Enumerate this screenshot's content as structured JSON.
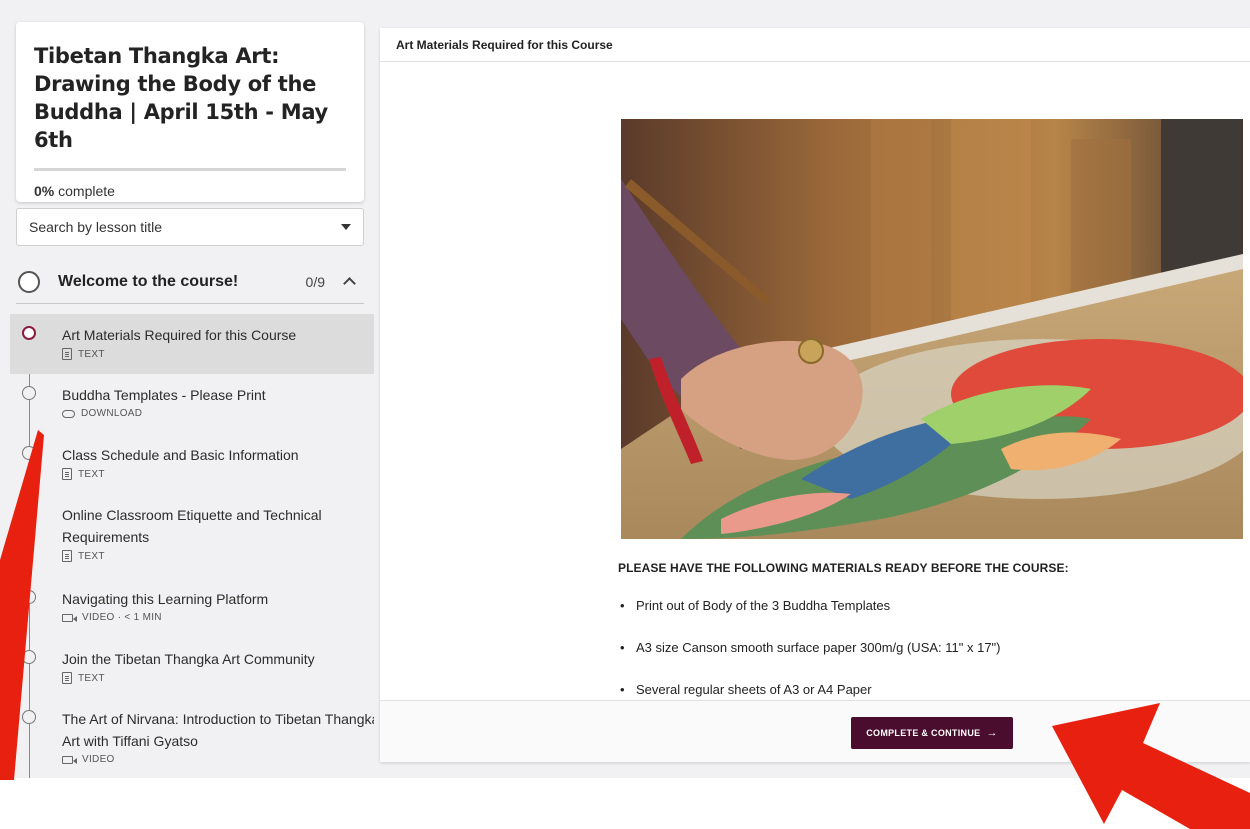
{
  "course": {
    "title": "Tibetan Thangka Art: Drawing the Body of the Buddha | April 15th - May 6th",
    "progress_percent": 0,
    "progress_value": "0%",
    "progress_suffix": " complete"
  },
  "search": {
    "label": "Search by lesson title"
  },
  "section": {
    "title": "Welcome to the course!",
    "count": "0/9"
  },
  "lessons": [
    {
      "title": "Art Materials Required for this Course",
      "meta": "TEXT",
      "icon": "text-icon",
      "active": true
    },
    {
      "title": "Buddha Templates - Please Print",
      "meta": "DOWNLOAD",
      "icon": "cloud-download-icon"
    },
    {
      "title": "Class Schedule and Basic Information",
      "meta": "TEXT",
      "icon": "text-icon"
    },
    {
      "title": "Online Classroom Etiquette and Technical Requirements",
      "meta": "TEXT",
      "icon": "text-icon"
    },
    {
      "title": "Navigating this Learning Platform",
      "meta": "VIDEO · < 1 MIN",
      "icon": "video-icon"
    },
    {
      "title": "Join the Tibetan Thangka Art Community",
      "meta": "TEXT",
      "icon": "text-icon"
    },
    {
      "title": "The Art of Nirvana: Introduction to Tibetan Thangka Art with Tiffani Gyatso",
      "meta": "VIDEO",
      "icon": "video-icon"
    }
  ],
  "main": {
    "header": "Art Materials Required for this Course",
    "materials_heading": "PLEASE HAVE THE FOLLOWING MATERIALS READY BEFORE THE COURSE:",
    "materials": [
      "Print out of Body of the 3 Buddha Templates",
      "A3 size Canson smooth surface paper 300m/g (USA: 11\" x 17\")",
      "Several regular sheets of A3 or A4 Paper"
    ],
    "complete_button": "COMPLETE & CONTINUE",
    "complete_arrow": "→"
  },
  "colors": {
    "brand": "#4a0d2e",
    "active_accent": "#8a1b3c",
    "annotation_arrow": "#e8200f"
  }
}
